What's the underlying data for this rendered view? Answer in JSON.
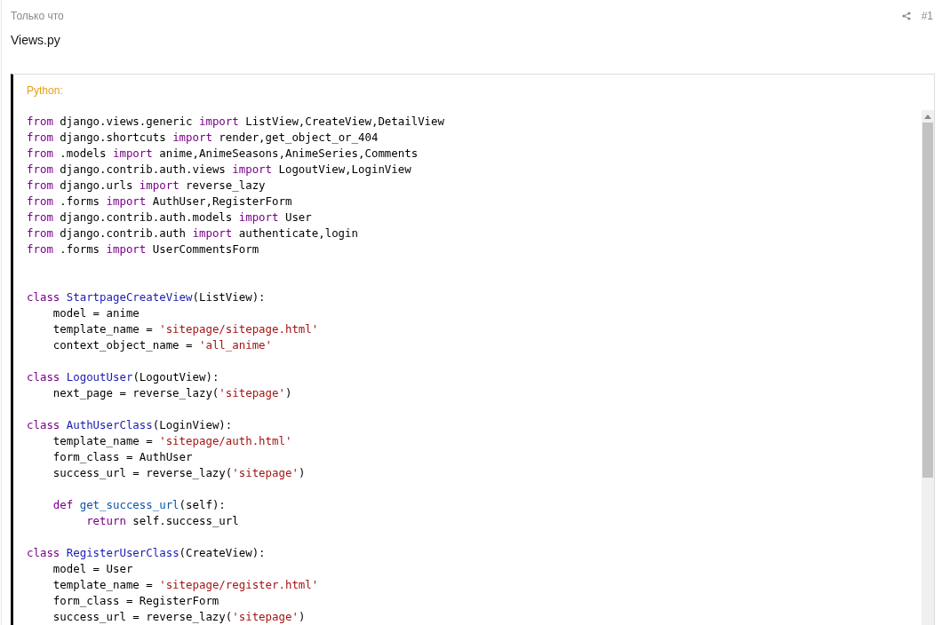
{
  "post": {
    "time": "Только что",
    "number": "#1",
    "title": "Views.py"
  },
  "code_block": {
    "language": "Python:",
    "lines": [
      {
        "kind": "code",
        "segments": [
          {
            "kind": "kw",
            "text": "from"
          },
          {
            "kind": "text",
            "text": " django.views.generic "
          },
          {
            "kind": "kw",
            "text": "import"
          },
          {
            "kind": "text",
            "text": " ListView,CreateView,DetailView"
          }
        ]
      },
      {
        "kind": "code",
        "segments": [
          {
            "kind": "kw",
            "text": "from"
          },
          {
            "kind": "text",
            "text": " django.shortcuts "
          },
          {
            "kind": "kw",
            "text": "import"
          },
          {
            "kind": "text",
            "text": " render,get_object_or_404"
          }
        ]
      },
      {
        "kind": "code",
        "segments": [
          {
            "kind": "kw",
            "text": "from"
          },
          {
            "kind": "text",
            "text": " .models "
          },
          {
            "kind": "kw",
            "text": "import"
          },
          {
            "kind": "text",
            "text": " anime,AnimeSeasons,AnimeSeries,Comments"
          }
        ]
      },
      {
        "kind": "code",
        "segments": [
          {
            "kind": "kw",
            "text": "from"
          },
          {
            "kind": "text",
            "text": " django.contrib.auth.views "
          },
          {
            "kind": "kw",
            "text": "import"
          },
          {
            "kind": "text",
            "text": " LogoutView,LoginView"
          }
        ]
      },
      {
        "kind": "code",
        "segments": [
          {
            "kind": "kw",
            "text": "from"
          },
          {
            "kind": "text",
            "text": " django.urls "
          },
          {
            "kind": "kw",
            "text": "import"
          },
          {
            "kind": "text",
            "text": " reverse_lazy"
          }
        ]
      },
      {
        "kind": "code",
        "segments": [
          {
            "kind": "kw",
            "text": "from"
          },
          {
            "kind": "text",
            "text": " .forms "
          },
          {
            "kind": "kw",
            "text": "import"
          },
          {
            "kind": "text",
            "text": " AuthUser,RegisterForm"
          }
        ]
      },
      {
        "kind": "code",
        "segments": [
          {
            "kind": "kw",
            "text": "from"
          },
          {
            "kind": "text",
            "text": " django.contrib.auth.models "
          },
          {
            "kind": "kw",
            "text": "import"
          },
          {
            "kind": "text",
            "text": " User"
          }
        ]
      },
      {
        "kind": "code",
        "segments": [
          {
            "kind": "kw",
            "text": "from"
          },
          {
            "kind": "text",
            "text": " django.contrib.auth "
          },
          {
            "kind": "kw",
            "text": "import"
          },
          {
            "kind": "text",
            "text": " authenticate,login"
          }
        ]
      },
      {
        "kind": "code",
        "segments": [
          {
            "kind": "kw",
            "text": "from"
          },
          {
            "kind": "text",
            "text": " .forms "
          },
          {
            "kind": "kw",
            "text": "import"
          },
          {
            "kind": "text",
            "text": " UserCommentsForm"
          }
        ]
      },
      {
        "kind": "blank"
      },
      {
        "kind": "blank"
      },
      {
        "kind": "code",
        "segments": [
          {
            "kind": "kw",
            "text": "class"
          },
          {
            "kind": "def",
            "text": " StartpageCreateView"
          },
          {
            "kind": "text",
            "text": "(ListView):"
          }
        ]
      },
      {
        "kind": "code",
        "segments": [
          {
            "kind": "text",
            "text": "    model = anime"
          }
        ]
      },
      {
        "kind": "code",
        "segments": [
          {
            "kind": "text",
            "text": "    template_name = "
          },
          {
            "kind": "str",
            "text": "'sitepage/sitepage.html'"
          }
        ]
      },
      {
        "kind": "code",
        "segments": [
          {
            "kind": "text",
            "text": "    context_object_name = "
          },
          {
            "kind": "str",
            "text": "'all_anime'"
          }
        ]
      },
      {
        "kind": "blank"
      },
      {
        "kind": "code",
        "segments": [
          {
            "kind": "kw",
            "text": "class"
          },
          {
            "kind": "def",
            "text": " LogoutUser"
          },
          {
            "kind": "text",
            "text": "(LogoutView):"
          }
        ]
      },
      {
        "kind": "code",
        "segments": [
          {
            "kind": "text",
            "text": "    next_page = reverse_lazy("
          },
          {
            "kind": "str",
            "text": "'sitepage'"
          },
          {
            "kind": "text",
            "text": ")"
          }
        ]
      },
      {
        "kind": "blank"
      },
      {
        "kind": "code",
        "segments": [
          {
            "kind": "kw",
            "text": "class"
          },
          {
            "kind": "def",
            "text": " AuthUserClass"
          },
          {
            "kind": "text",
            "text": "(LoginView):"
          }
        ]
      },
      {
        "kind": "code",
        "segments": [
          {
            "kind": "text",
            "text": "    template_name = "
          },
          {
            "kind": "str",
            "text": "'sitepage/auth.html'"
          }
        ]
      },
      {
        "kind": "code",
        "segments": [
          {
            "kind": "text",
            "text": "    form_class = AuthUser"
          }
        ]
      },
      {
        "kind": "code",
        "segments": [
          {
            "kind": "text",
            "text": "    success_url = reverse_lazy("
          },
          {
            "kind": "str",
            "text": "'sitepage'"
          },
          {
            "kind": "text",
            "text": ")"
          }
        ]
      },
      {
        "kind": "blank"
      },
      {
        "kind": "code",
        "segments": [
          {
            "kind": "kw",
            "text": "    def"
          },
          {
            "kind": "fn",
            "text": " get_success_url"
          },
          {
            "kind": "text",
            "text": "(self):"
          }
        ]
      },
      {
        "kind": "code",
        "segments": [
          {
            "kind": "kw",
            "text": "         return"
          },
          {
            "kind": "text",
            "text": " self.success_url"
          }
        ]
      },
      {
        "kind": "blank"
      },
      {
        "kind": "code",
        "segments": [
          {
            "kind": "kw",
            "text": "class"
          },
          {
            "kind": "def",
            "text": " RegisterUserClass"
          },
          {
            "kind": "text",
            "text": "(CreateView):"
          }
        ]
      },
      {
        "kind": "code",
        "segments": [
          {
            "kind": "text",
            "text": "    model = User"
          }
        ]
      },
      {
        "kind": "code",
        "segments": [
          {
            "kind": "text",
            "text": "    template_name = "
          },
          {
            "kind": "str",
            "text": "'sitepage/register.html'"
          }
        ]
      },
      {
        "kind": "code",
        "segments": [
          {
            "kind": "text",
            "text": "    form_class = RegisterForm"
          }
        ]
      },
      {
        "kind": "code",
        "segments": [
          {
            "kind": "text",
            "text": "    success_url = reverse_lazy("
          },
          {
            "kind": "str",
            "text": "'sitepage'"
          },
          {
            "kind": "text",
            "text": ")"
          }
        ]
      }
    ]
  }
}
